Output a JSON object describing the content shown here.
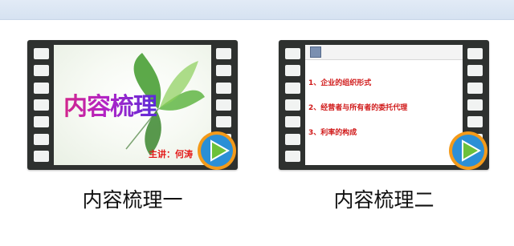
{
  "window": {
    "accent_color": "#dbe6f4"
  },
  "files": [
    {
      "name": "内容梳理一",
      "thumbnail": {
        "title": "内容梳理",
        "speaker": "主讲：何涛"
      },
      "icon": "video-play-icon"
    },
    {
      "name": "内容梳理二",
      "thumbnail": {
        "items": [
          "1、企业的组织形式",
          "2、经营者与所有者的委托代理",
          "3、利率的构成"
        ]
      },
      "icon": "video-play-icon"
    }
  ],
  "colors": {
    "film": "#2e312f",
    "slide_text_red": "#d01818",
    "play_green": "#6cc13a",
    "play_blue": "#2b8fd6",
    "play_orange": "#f39a1a"
  }
}
